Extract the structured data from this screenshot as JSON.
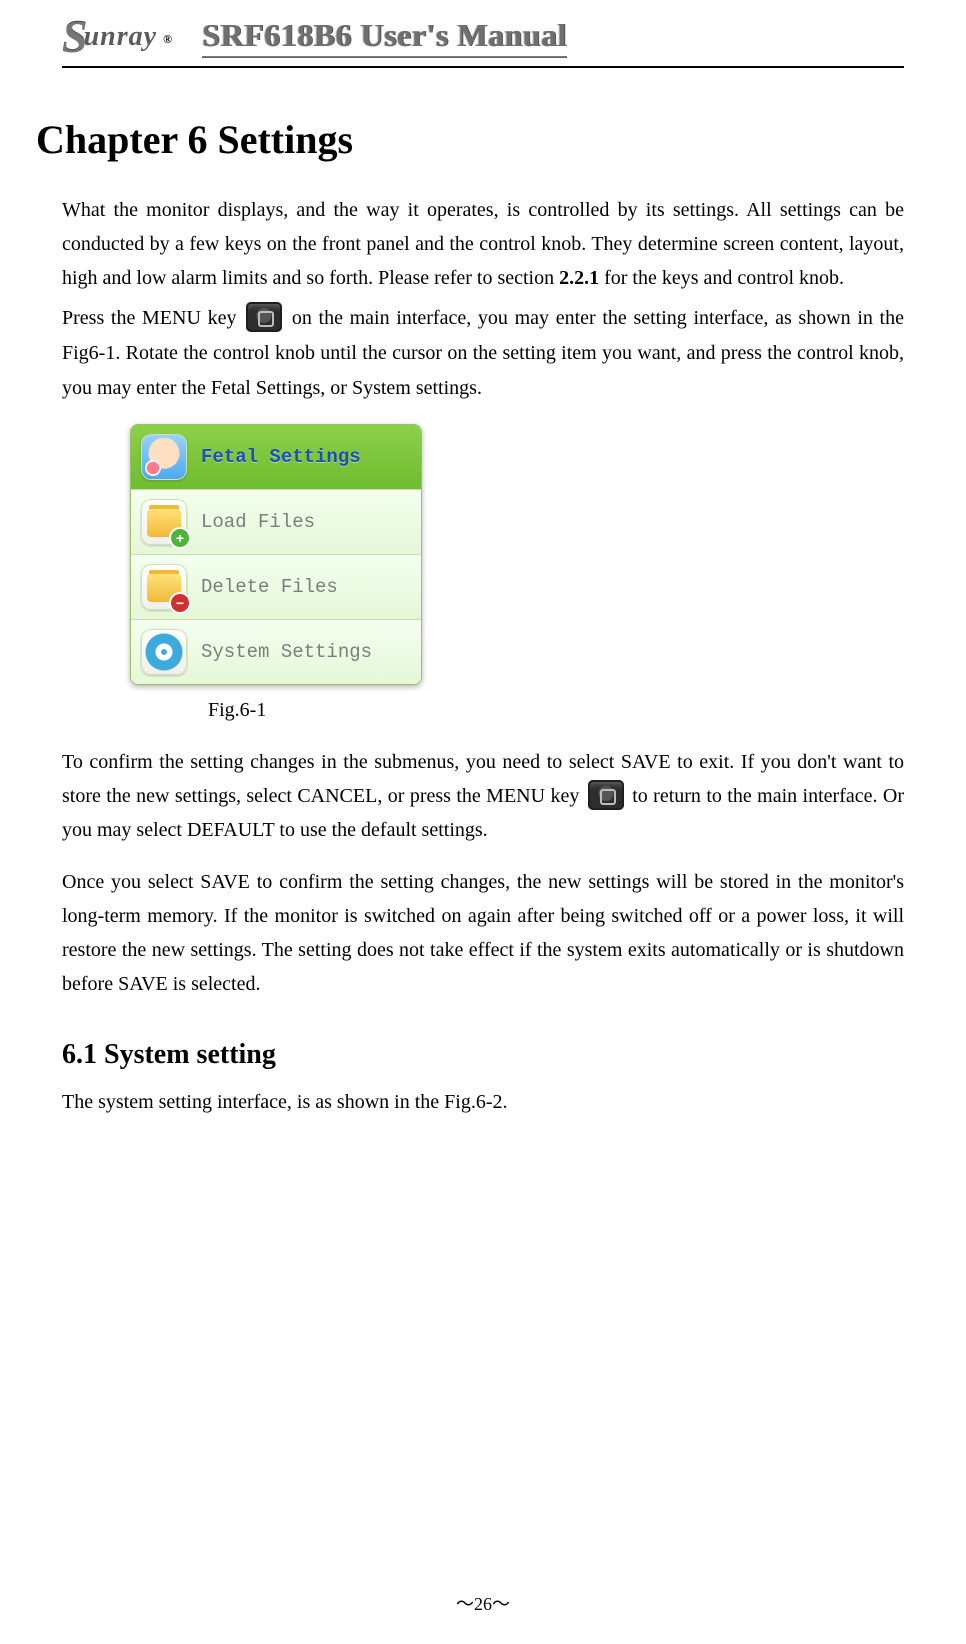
{
  "header": {
    "logo_initial": "S",
    "logo_rest": "unray",
    "reg": "®",
    "title": "SRF618B6 User's Manual"
  },
  "chapter_title": "Chapter 6  Settings",
  "para1": "What the monitor displays, and the way it operates, is controlled by its settings. All settings can be conducted by a few keys on the front panel and the control knob. They determine screen content, layout, high and low alarm limits and so forth. Please refer to section ",
  "para1_ref": "2.2.1",
  "para1_after": " for the keys and control knob.",
  "para2_a": "Press the MENU key ",
  "para2_b": " on the main interface, you may enter the setting interface, as shown in the Fig6-1. Rotate the control knob until the cursor on the setting item you want, and press the control knob, you may enter the Fetal Settings, or System settings.",
  "menu": {
    "items": [
      {
        "label": "Fetal Settings"
      },
      {
        "label": "Load Files"
      },
      {
        "label": "Delete Files"
      },
      {
        "label": "System Settings"
      }
    ]
  },
  "fig_caption": "Fig.6-1",
  "para3_a": "To confirm the setting changes in the submenus, you need to select SAVE to exit. If you don't want to store the new settings, select CANCEL, or press the MENU key ",
  "para3_b": "to return to the main interface. Or you may select DEFAULT to use the default settings.",
  "para4": "Once you select SAVE to confirm the setting changes, the new settings will be stored in the monitor's long-term memory. If the monitor is switched on again after being switched off or a power loss, it will restore the new settings. The setting does not take effect if the system exits automatically or is shutdown before SAVE is selected.",
  "section_heading": "6.1 System setting",
  "para5": "The system setting interface, is as shown in the Fig.6-2.",
  "page_number": "～26～"
}
